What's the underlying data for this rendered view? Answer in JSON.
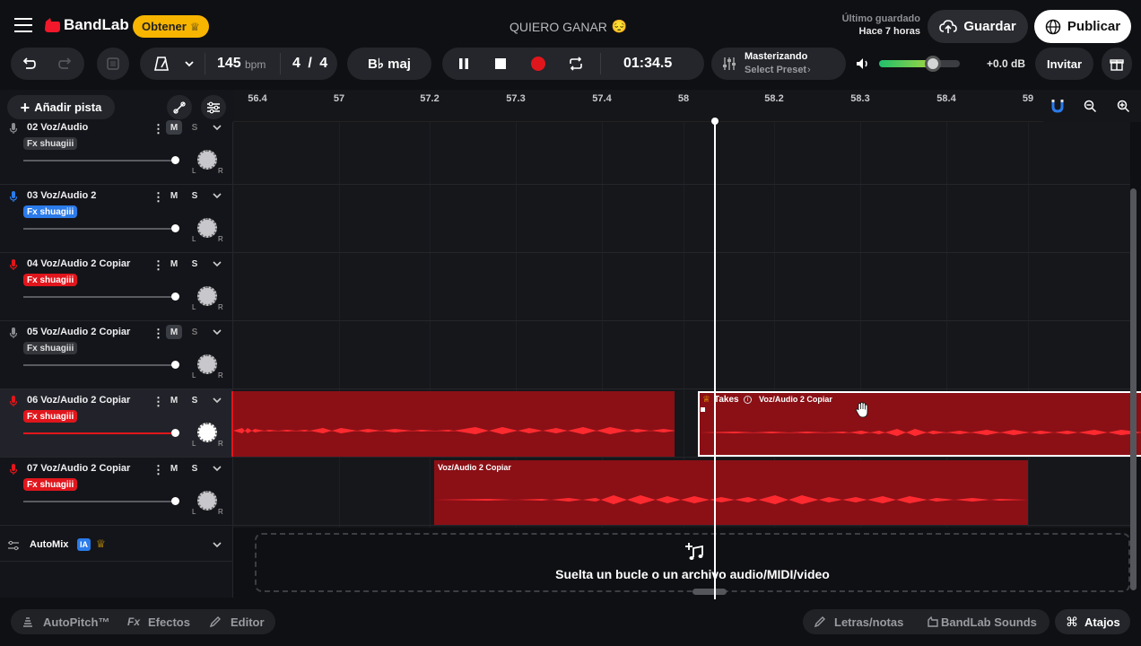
{
  "header": {
    "brand": "BandLab",
    "get_button": "Obtener",
    "project_title": "QUIERO GANAR",
    "title_emoji": "😔",
    "last_saved_label": "Último guardado",
    "last_saved_time": "Hace 7 horas",
    "save_button": "Guardar",
    "publish_button": "Publicar"
  },
  "toolbar": {
    "bpm_value": "145",
    "bpm_unit": "bpm",
    "time_sig_num": "4",
    "time_sig_sep": "/",
    "time_sig_den": "4",
    "key": "B♭ maj",
    "time_display": "01:34.5",
    "mastering_title": "Masterizando",
    "mastering_preset": "Select Preset",
    "volume_db": "+0.0 dB",
    "volume_level": 0.68,
    "invite_button": "Invitar"
  },
  "left_panel": {
    "add_track_button": "Añadir pista"
  },
  "ruler": {
    "labels": [
      "56.4",
      "57",
      "57.2",
      "57.3",
      "57.4",
      "58",
      "58.2",
      "58.3",
      "58.4",
      "59"
    ]
  },
  "tracks": [
    {
      "name": "02  Voz/Audio",
      "fx": "Fx shuagiii",
      "fx_style": "grey",
      "mic_color": "#8b8c91",
      "mute_active": true
    },
    {
      "name": "03  Voz/Audio 2",
      "fx": "Fx shuagiii",
      "fx_style": "blue",
      "mic_color": "#2b7bea",
      "mute_active": false
    },
    {
      "name": "04  Voz/Audio 2 Copiar",
      "fx": "Fx shuagiii",
      "fx_style": "red",
      "mic_color": "#e0161c",
      "mute_active": false
    },
    {
      "name": "05  Voz/Audio 2 Copiar",
      "fx": "Fx shuagiii",
      "fx_style": "grey",
      "mic_color": "#8b8c91",
      "mute_active": true
    },
    {
      "name": "06  Voz/Audio 2 Copiar",
      "fx": "Fx shuagiii",
      "fx_style": "red",
      "mic_color": "#e0161c",
      "mute_active": false
    },
    {
      "name": "07  Voz/Audio 2 Copiar",
      "fx": "Fx shuagiii",
      "fx_style": "red",
      "mic_color": "#e0161c",
      "mute_active": false
    }
  ],
  "track_controls": {
    "mute": "M",
    "solo": "S",
    "left": "L",
    "right": "R"
  },
  "automix": {
    "label": "AutoMix",
    "ai_badge": "IA"
  },
  "clips": {
    "takes_label": "Takes",
    "takes_clip_name": "Voz/Audio 2 Copiar",
    "track7_clip_name": "Voz/Audio 2 Copiar"
  },
  "dropzone": {
    "text": "Suelta un bucle o un archivo audio/MIDI/video"
  },
  "bottom": {
    "autopitch": "AutoPitch™",
    "effects": "Efectos",
    "editor": "Editor",
    "lyrics": "Letras/notas",
    "sounds": "BandLab Sounds",
    "shortcuts": "Atajos"
  },
  "colors": {
    "accent_red": "#e0161c",
    "clip_red": "#8a1016",
    "brand_yellow": "#f7b500",
    "blue": "#2b7bea"
  }
}
